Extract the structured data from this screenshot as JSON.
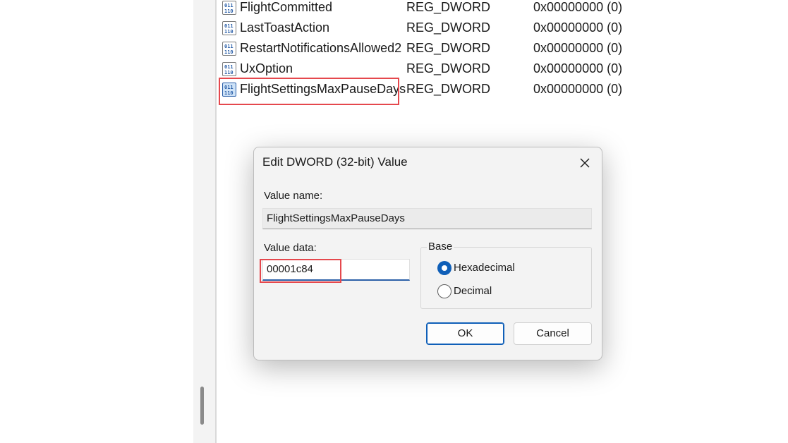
{
  "registry_values": [
    {
      "name": "FlightCommitted",
      "type": "REG_DWORD",
      "data": "0x00000000 (0)"
    },
    {
      "name": "LastToastAction",
      "type": "REG_DWORD",
      "data": "0x00000000 (0)"
    },
    {
      "name": "RestartNotificationsAllowed2",
      "type": "REG_DWORD",
      "data": "0x00000000 (0)"
    },
    {
      "name": "UxOption",
      "type": "REG_DWORD",
      "data": "0x00000000 (0)"
    },
    {
      "name": "FlightSettingsMaxPauseDays",
      "type": "REG_DWORD",
      "data": "0x00000000 (0)"
    }
  ],
  "dialog": {
    "title": "Edit DWORD (32-bit) Value",
    "value_name_label": "Value name:",
    "value_name": "FlightSettingsMaxPauseDays",
    "value_data_label": "Value data:",
    "value_data": "00001c84",
    "base_label": "Base",
    "base_options": [
      {
        "label": "Hexadecimal",
        "selected": true
      },
      {
        "label": "Decimal",
        "selected": false
      }
    ],
    "ok_label": "OK",
    "cancel_label": "Cancel"
  },
  "icons": {
    "value_icon": "reg-dword-icon",
    "close": "close-icon"
  },
  "colors": {
    "highlight": "#e5484d",
    "accent": "#0f5fb8"
  }
}
